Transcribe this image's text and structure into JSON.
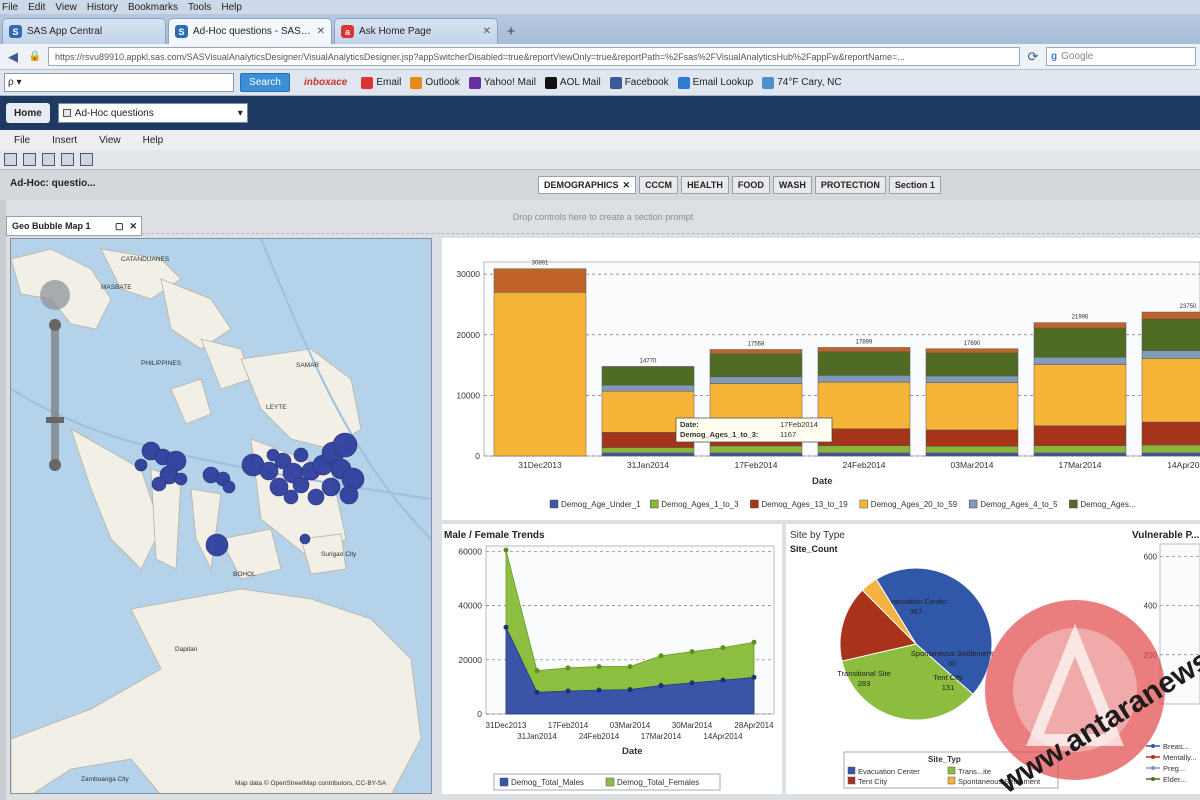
{
  "browser": {
    "menu": [
      "File",
      "Edit",
      "View",
      "History",
      "Bookmarks",
      "Tools",
      "Help"
    ],
    "tabs": [
      {
        "label": "SAS App Central",
        "icon": "sas-icon"
      },
      {
        "label": "Ad-Hoc questions - SAS Vi...",
        "icon": "sas-icon"
      },
      {
        "label": "Ask Home Page",
        "icon": "ask-icon"
      }
    ],
    "new_tab": "+",
    "url": "https://rsvu89910.appkl.sas.com/SASVisualAnalyticsDesigner/VisualAnalyticsDesigner.jsp?appSwitcherDisabled=true&reportViewOnly=true&reportPath=%2Fsas%2FVisualAnalyticsHub%2FappFw&reportName=...",
    "google_placeholder": "Google",
    "bookmark_search_placeholder": "ρ ▾",
    "bookmark_search_button": "Search",
    "bookmarks": [
      {
        "label": "Email",
        "color": "#d33"
      },
      {
        "label": "Outlook",
        "color": "#e88a1a"
      },
      {
        "label": "Yahoo! Mail",
        "color": "#6b2fa0"
      },
      {
        "label": "AOL Mail",
        "color": "#111"
      },
      {
        "label": "Facebook",
        "color": "#3b5998"
      },
      {
        "label": "Email Lookup",
        "color": "#2e7bd1"
      },
      {
        "label": "74°F Cary, NC",
        "color": "#4a90d0"
      }
    ]
  },
  "sas": {
    "home": "Home",
    "report_select": "Ad-Hoc questions",
    "menu": [
      "File",
      "Insert",
      "View",
      "Help"
    ],
    "report_title": "Ad-Hoc: questio...",
    "section_tabs": [
      "DEMOGRAPHICS",
      "CCCM",
      "HEALTH",
      "FOOD",
      "WASH",
      "PROTECTION",
      "Section 1"
    ],
    "drop_hint": "Drop controls here to create a section prompt",
    "map_tab": "Geo Bubble Map 1",
    "map_places": [
      "CATANDUANES",
      "MASBATE",
      "PHILIPPINES",
      "SAMAR",
      "LEYTE",
      "BOHOL",
      "Dapitan",
      "Zamboanga City",
      "Surigao City"
    ],
    "map_credit": "Map data © OpenStreetMap contributors, CC-BY-SA"
  },
  "chart_data": [
    {
      "type": "bar",
      "title": "",
      "xlabel": "Date",
      "ylabel": "",
      "ylim": [
        0,
        32000
      ],
      "yticks": [
        0,
        10000,
        20000,
        30000
      ],
      "categories": [
        "31Dec2013",
        "31Jan2014",
        "17Feb2014",
        "24Feb2014",
        "03Mar2014",
        "17Mar2014",
        "14Apr2014"
      ],
      "totals": [
        "30891",
        "14770",
        "17568",
        "17899",
        "17690",
        "21996",
        "23750"
      ],
      "series": [
        {
          "name": "Demog_Age_Under_1",
          "color": "#3a55a8",
          "values": [
            0,
            500,
            500,
            500,
            500,
            500,
            500
          ]
        },
        {
          "name": "Demog_Ages_1_to_3",
          "color": "#8cb33a",
          "values": [
            0,
            900,
            1167,
            1200,
            1100,
            1200,
            1300
          ]
        },
        {
          "name": "Demog_Ages_13_to_19",
          "color": "#a5341b",
          "values": [
            0,
            2500,
            2700,
            2800,
            2700,
            3300,
            3800
          ]
        },
        {
          "name": "Demog_Ages_20_to_59",
          "color": "#f6b538",
          "values": [
            27000,
            6800,
            7600,
            7700,
            7800,
            10100,
            10500
          ]
        },
        {
          "name": "Demog_Ages_4_to_5",
          "color": "#7f9bb8",
          "values": [
            0,
            1000,
            1100,
            1100,
            1100,
            1200,
            1300
          ]
        },
        {
          "name": "Demog_Ages...",
          "color": "#4f6a22",
          "values": [
            0,
            3000,
            3800,
            3900,
            3800,
            4800,
            5200
          ]
        },
        {
          "name": "",
          "color": "#c0632a",
          "values": [
            3891,
            70,
            701,
            699,
            690,
            896,
            1150
          ]
        }
      ],
      "tooltip": {
        "label1": "Date:",
        "value1": "17Feb2014",
        "label2": "Demog_Ages_1_to_3:",
        "value2": "1167"
      }
    },
    {
      "type": "area",
      "title": "Male / Female Trends",
      "xlabel": "Date",
      "ylabel": "",
      "ylim": [
        0,
        62000
      ],
      "yticks": [
        0,
        20000,
        40000,
        60000
      ],
      "x": [
        "31Dec2013",
        "31Jan2014",
        "17Feb2014",
        "24Feb2014",
        "03Mar2014",
        "17Mar2014",
        "30Mar2014",
        "14Apr2014",
        "28Apr2014"
      ],
      "xlabels_top": [
        "31Dec2013",
        "17Feb2014",
        "03Mar2014",
        "30Mar2014",
        "28Apr2014"
      ],
      "xlabels_bottom": [
        "31Jan2014",
        "24Feb2014",
        "17Mar2014",
        "14Apr2014"
      ],
      "series": [
        {
          "name": "Demog_Total_Males",
          "color": "#3a55a8",
          "values": [
            32000,
            8000,
            8500,
            8800,
            9000,
            10500,
            11500,
            12500,
            13500
          ]
        },
        {
          "name": "Demog_Total_Females",
          "color": "#8cbf3f",
          "values": [
            60500,
            16000,
            17000,
            17500,
            17500,
            21500,
            23000,
            24500,
            26500
          ]
        }
      ]
    },
    {
      "type": "pie",
      "title": "Site by Type",
      "subtitle": "Site_Count",
      "legend_title": "Site_Typ",
      "slices": [
        {
          "label": "Evacuation Center",
          "value": 367,
          "color": "#3157a8"
        },
        {
          "label": "Transitional Site",
          "value": 283,
          "color": "#8cbd3f"
        },
        {
          "label": "Tent City",
          "value": 131,
          "color": "#a8321a"
        },
        {
          "label": "Spontaneous Settlement",
          "value": 30,
          "color": "#f3b340"
        }
      ],
      "legend_visible": [
        "Evacuation Center",
        "Trans...ite",
        "Tent City",
        "Spontaneous Settlement"
      ]
    },
    {
      "type": "line",
      "title": "Vulnerable P...",
      "yticks": [
        200,
        400,
        600
      ],
      "legend": [
        "Breas...",
        "Mentally...",
        "Preg...",
        "Elder..."
      ]
    }
  ],
  "watermark": "www.antaranews.com"
}
